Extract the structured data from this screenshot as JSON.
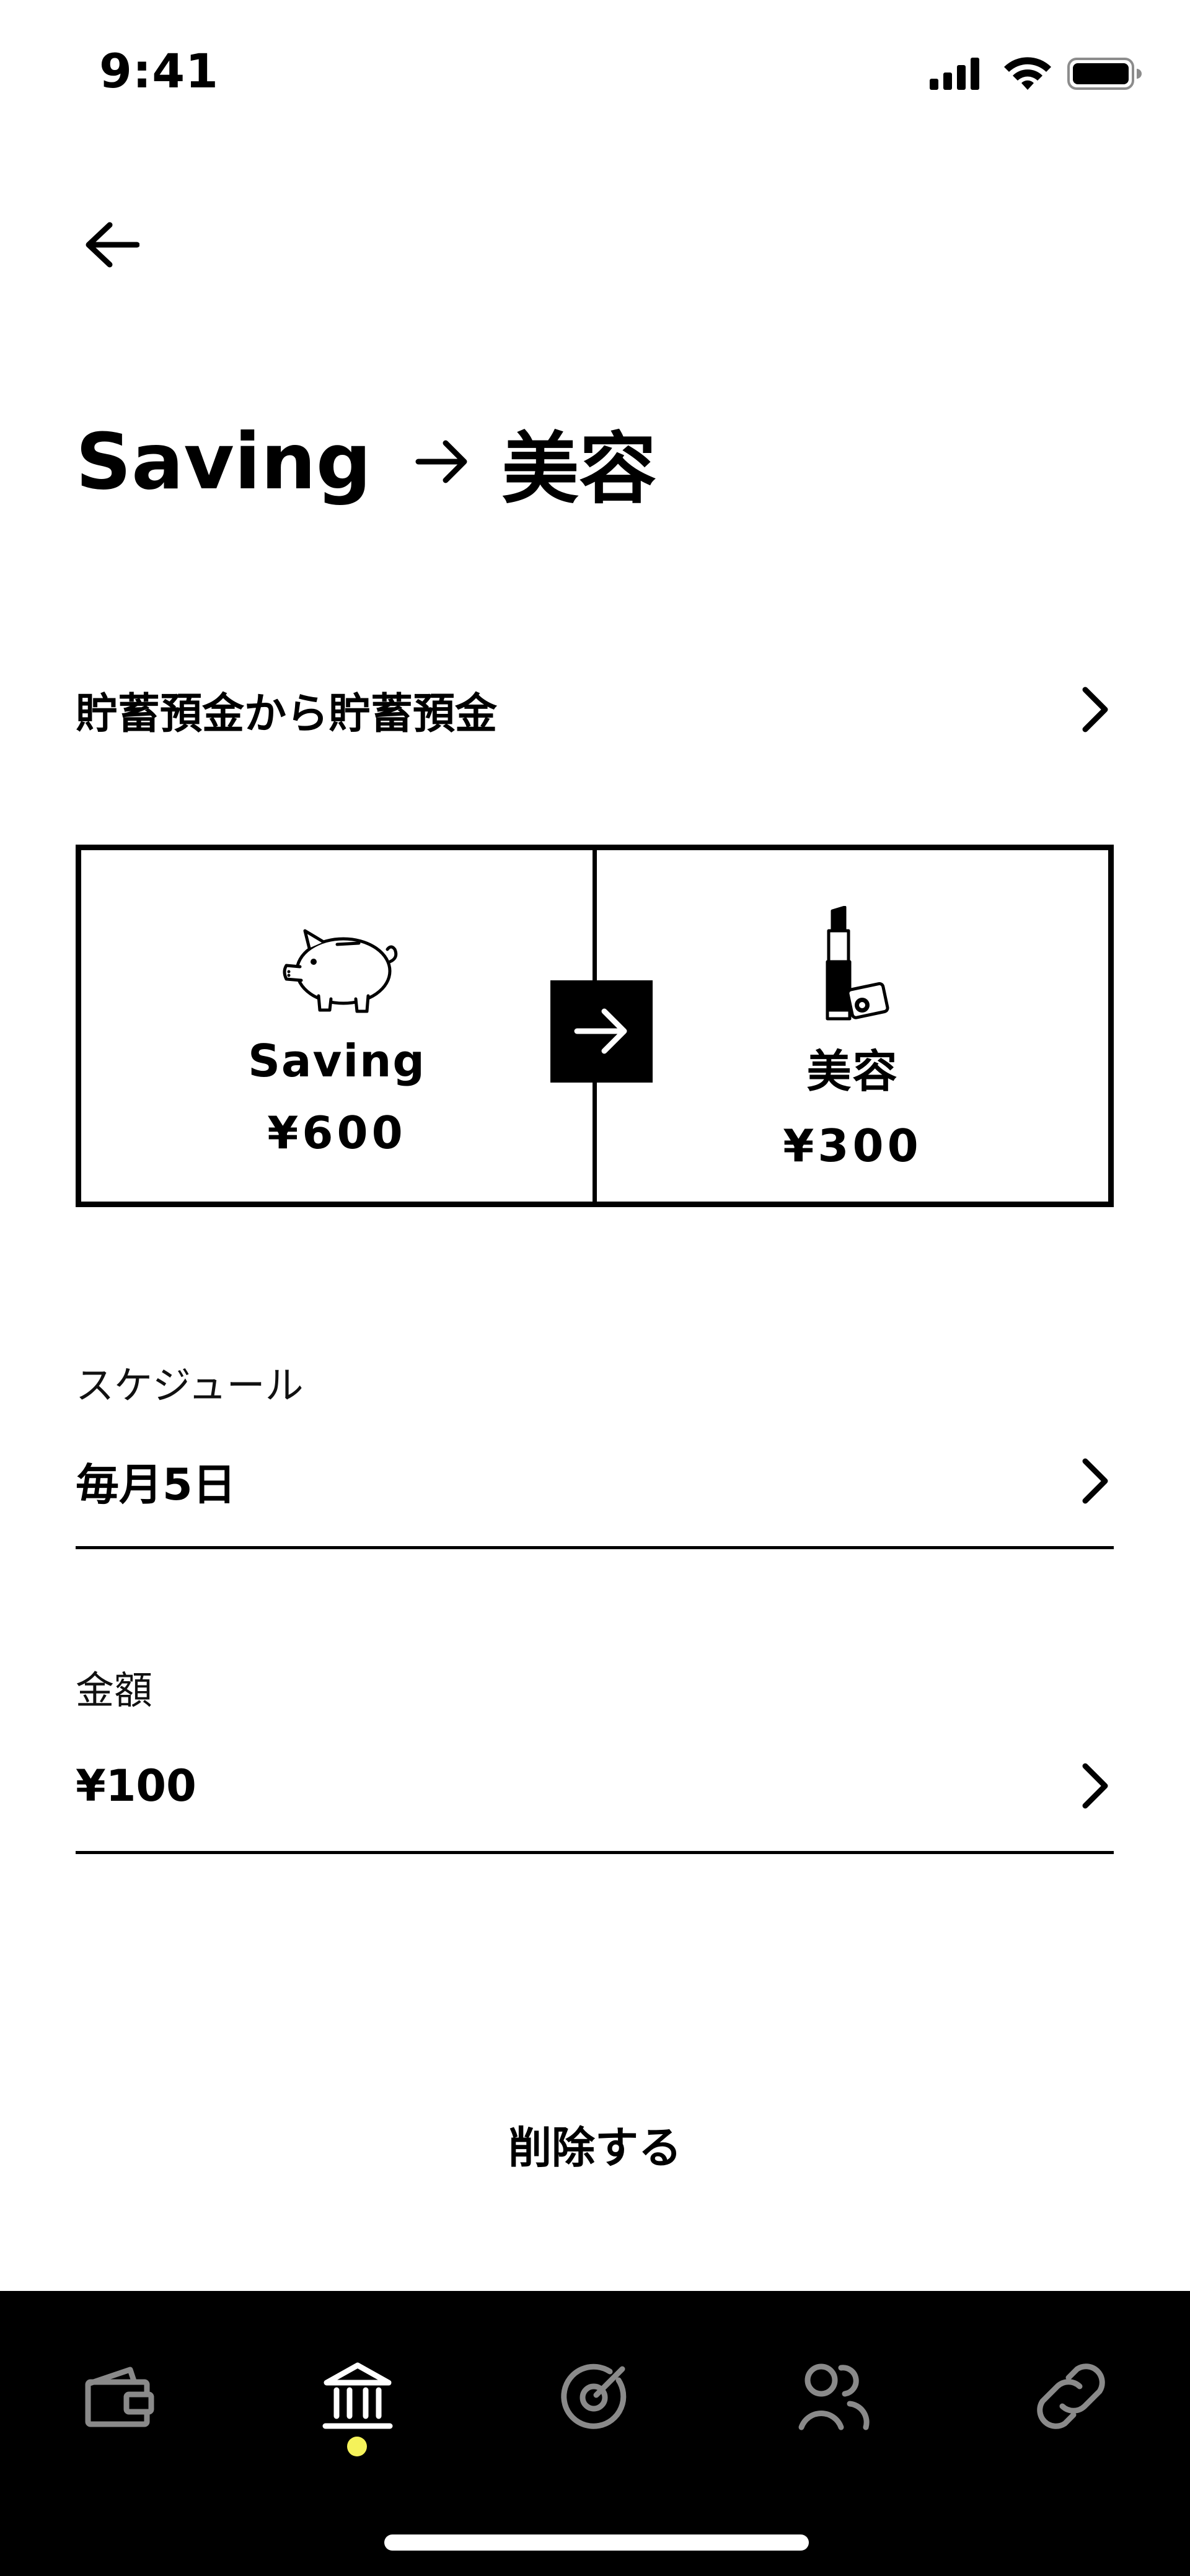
{
  "status_bar": {
    "time": "9:41"
  },
  "header": {
    "title_from": "Saving",
    "title_to": "美容"
  },
  "route": {
    "label": "貯蓄預金から貯蓄預金"
  },
  "transfer": {
    "from": {
      "name": "Saving",
      "amount": "¥600",
      "icon": "piggy-bank-icon"
    },
    "to": {
      "name": "美容",
      "amount": "¥300",
      "icon": "lipstick-icon"
    }
  },
  "schedule": {
    "caption": "スケジュール",
    "value": "毎月5日"
  },
  "amount": {
    "caption": "金額",
    "value": "¥100"
  },
  "delete_label": "削除する",
  "tabbar": {
    "items": [
      "wallet-icon",
      "bank-icon",
      "target-icon",
      "people-icon",
      "link-icon"
    ],
    "active_index": 1
  },
  "colors": {
    "accent": "#f5f25a",
    "inactive_tab": "#8a8a8a",
    "active_tab": "#ffffff"
  }
}
